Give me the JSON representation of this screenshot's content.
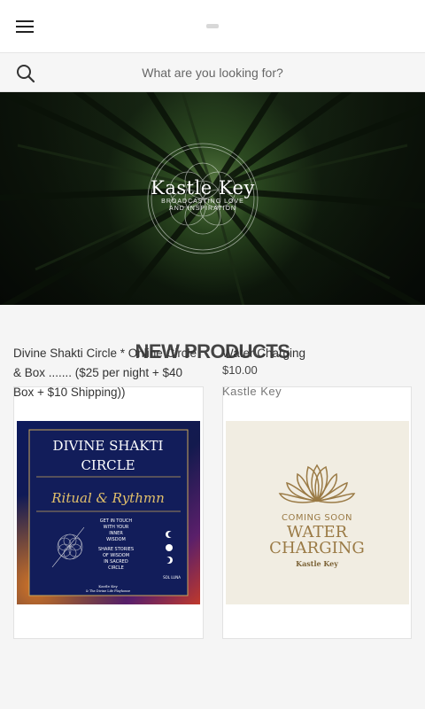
{
  "header": {
    "menu_icon": "hamburger-menu-icon"
  },
  "search": {
    "placeholder": "What are you looking for?",
    "icon": "search-icon"
  },
  "hero": {
    "title": "Kastle Key",
    "tagline_line1": "BROADCASTING LOVE",
    "tagline_line2": "AND INSPIRATION"
  },
  "section": {
    "title": "NEW PRODUCTS"
  },
  "products": [
    {
      "name": "Divine Shakti Circle * Online Circle & Box ....... ($25 per night + $40 Box + $10 Shipping))",
      "image_text": {
        "title1": "DIVINE SHAKTI",
        "title2": "CIRCLE",
        "subtitle": "Ritual & Rythmn",
        "blurb1": "GET IN TOUCH",
        "blurb2": "WITH YOUR",
        "blurb3": "INNER",
        "blurb4": "WISDOM",
        "blurb5": "SHARE STORIES",
        "blurb6": "OF WISDOM",
        "blurb7": "IN SACRED",
        "blurb8": "CIRCLE",
        "sol_luna": "SOL LUNA",
        "credit1": "Kastle Key",
        "credit2": "& The Divine Life Playhouse"
      }
    },
    {
      "name": "Water Charging",
      "price": "$10.00",
      "brand": "Kastle Key",
      "image_text": {
        "line1": "COMING SOON",
        "line2": "WATER",
        "line3": "CHARGING",
        "line4": "Kastle Key"
      }
    }
  ],
  "colors": {
    "gold": "#9a7a45",
    "navy": "#15205a",
    "section_bg": "#f5f5f5"
  }
}
